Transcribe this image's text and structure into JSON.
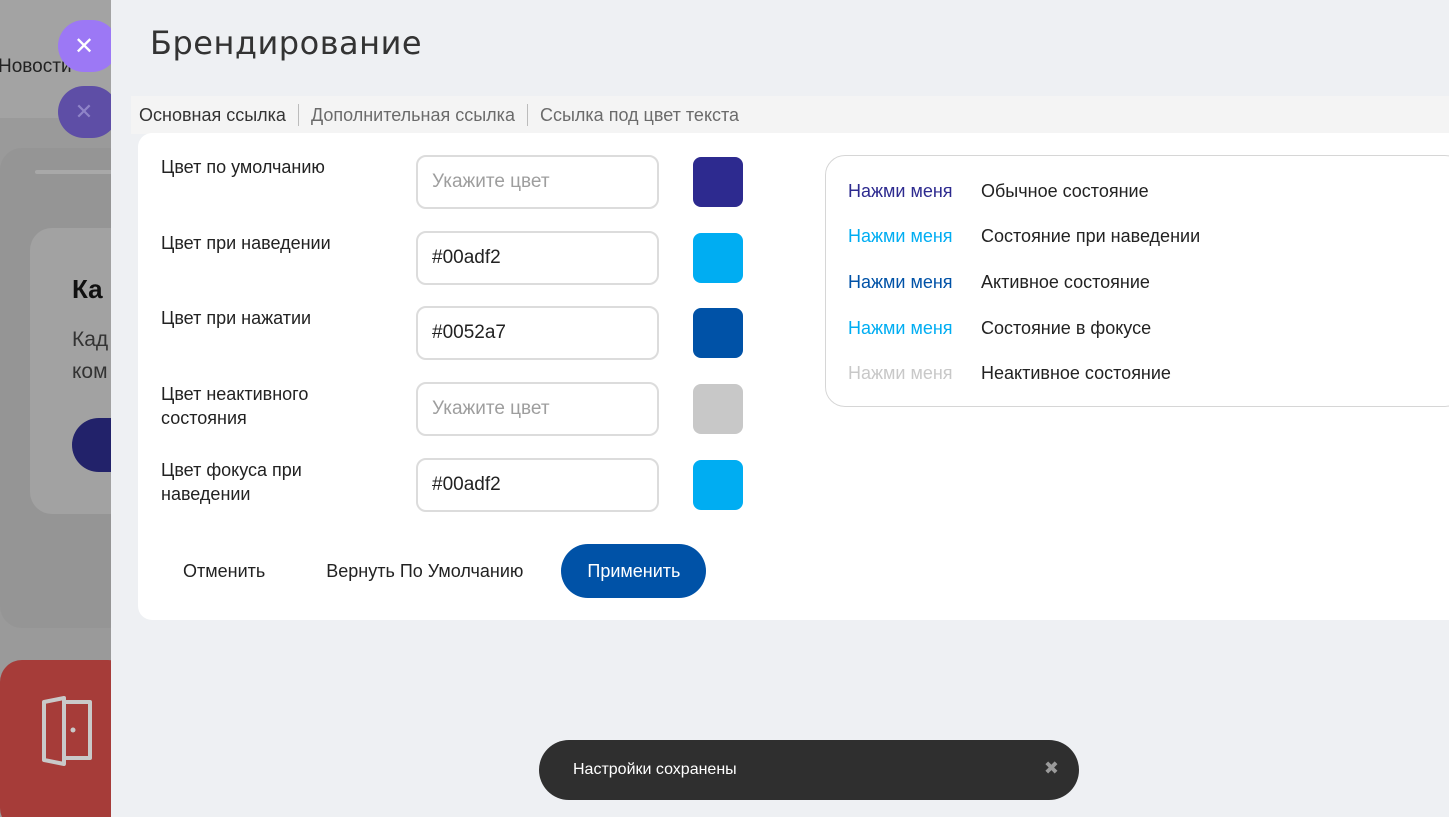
{
  "background": {
    "news_label": "Новости",
    "card_title": "Ка",
    "card_text_line1": "Кад",
    "card_text_line2": "ком"
  },
  "drawer": {
    "title": "Брендирование",
    "close_icon": "close-icon",
    "tabs": [
      {
        "label": "Основная ссылка",
        "active": true
      },
      {
        "label": "Дополнительная ссылка",
        "active": false
      },
      {
        "label": "Ссылка под цвет текста",
        "active": false
      }
    ],
    "fields": [
      {
        "label": "Цвет по умолчанию",
        "value": "",
        "placeholder": "Укажите цвет",
        "swatch": "#2d2a8f"
      },
      {
        "label": "Цвет при наведении",
        "value": "#00adf2",
        "placeholder": "Укажите цвет",
        "swatch": "#00adf2"
      },
      {
        "label": "Цвет при нажатии",
        "value": "#0052a7",
        "placeholder": "Укажите цвет",
        "swatch": "#0052a7"
      },
      {
        "label": "Цвет неактивного состояния",
        "value": "",
        "placeholder": "Укажите цвет",
        "swatch": "#c8c8c8"
      },
      {
        "label": "Цвет фокуса при наведении",
        "value": "#00adf2",
        "placeholder": "Укажите цвет",
        "swatch": "#00adf2"
      }
    ],
    "actions": {
      "cancel": "Отменить",
      "reset": "Вернуть По Умолчанию",
      "apply": "Применить"
    },
    "preview": [
      {
        "link": "Нажми меня",
        "desc": "Обычное состояние",
        "color": "#2d2a8f"
      },
      {
        "link": "Нажми меня",
        "desc": "Состояние при наведении",
        "color": "#00adf2"
      },
      {
        "link": "Нажми меня",
        "desc": "Активное состояние",
        "color": "#0052a7"
      },
      {
        "link": "Нажми меня",
        "desc": "Состояние в фокусе",
        "color": "#00adf2"
      },
      {
        "link": "Нажми меня",
        "desc": "Неактивное состояние",
        "color": "#c8c8c8"
      }
    ]
  },
  "toast": {
    "message": "Настройки сохранены",
    "close_icon": "close-icon"
  }
}
